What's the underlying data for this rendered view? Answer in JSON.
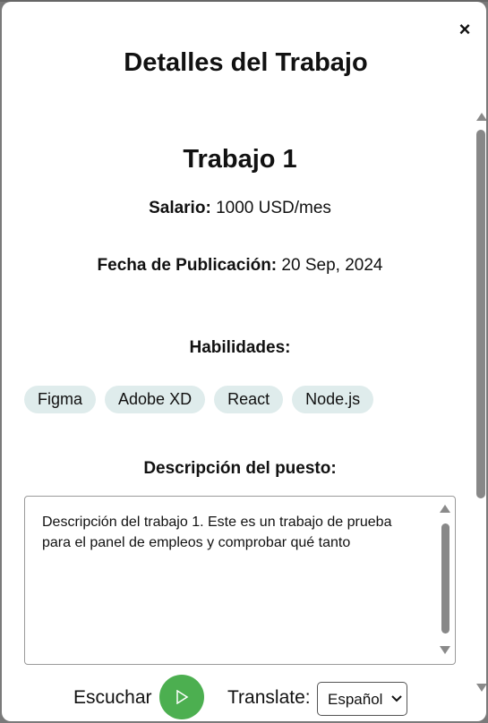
{
  "modal": {
    "title": "Detalles del Trabajo",
    "close_label": "×"
  },
  "job": {
    "title": "Trabajo 1",
    "salary_label": "Salario:",
    "salary_value": "1000 USD/mes",
    "date_label": "Fecha de Publicación:",
    "date_value": "20 Sep, 2024",
    "skills_heading": "Habilidades:",
    "skills": [
      "Figma",
      "Adobe XD",
      "React",
      "Node.js"
    ],
    "description_heading": "Descripción del puesto:",
    "description": "Descripción del trabajo 1. Este es un trabajo de prueba para el panel de empleos y comprobar qué tanto"
  },
  "controls": {
    "listen_label": "Escuchar",
    "translate_label": "Translate:",
    "language_selected": "Español"
  },
  "colors": {
    "accent_play": "#4caf50",
    "chip_bg": "#dfecec"
  }
}
